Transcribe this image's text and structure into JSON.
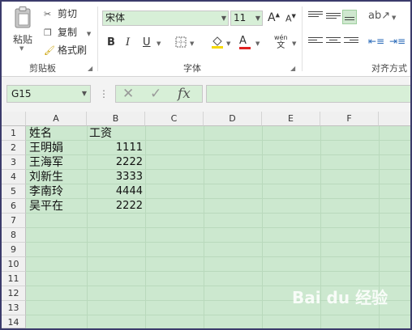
{
  "clipboard": {
    "paste_label": "粘贴",
    "cut_label": "剪切",
    "copy_label": "复制",
    "format_painter_label": "格式刷",
    "group_label": "剪贴板"
  },
  "font": {
    "name": "宋体",
    "size": "11",
    "grow_label": "A",
    "shrink_label": "A",
    "bold_label": "B",
    "italic_label": "I",
    "underline_label": "U",
    "phonetic_top": "wén",
    "phonetic_bottom": "文",
    "group_label": "字体",
    "font_color": "#e02020",
    "highlight_color": "#f5d800"
  },
  "alignment": {
    "group_label": "对齐方式"
  },
  "formula_bar": {
    "name_box": "G15",
    "fx_label": "fx",
    "value": ""
  },
  "sheet": {
    "columns": [
      "A",
      "B",
      "C",
      "D",
      "E",
      "F"
    ],
    "rows": [
      "1",
      "2",
      "3",
      "4",
      "5",
      "6",
      "7",
      "8",
      "9",
      "10",
      "11",
      "12",
      "13",
      "14"
    ],
    "cells": [
      {
        "a": "姓名",
        "b": "工资"
      },
      {
        "a": "王明娟",
        "b": "1111"
      },
      {
        "a": "王海军",
        "b": "2222"
      },
      {
        "a": "刘新生",
        "b": "3333"
      },
      {
        "a": "李南玲",
        "b": "4444"
      },
      {
        "a": "吴平在",
        "b": "2222"
      }
    ]
  },
  "watermark": "Bai du 经验",
  "colors": {
    "cell_background": "#cce8cf",
    "frame": "#3b3b6b"
  }
}
